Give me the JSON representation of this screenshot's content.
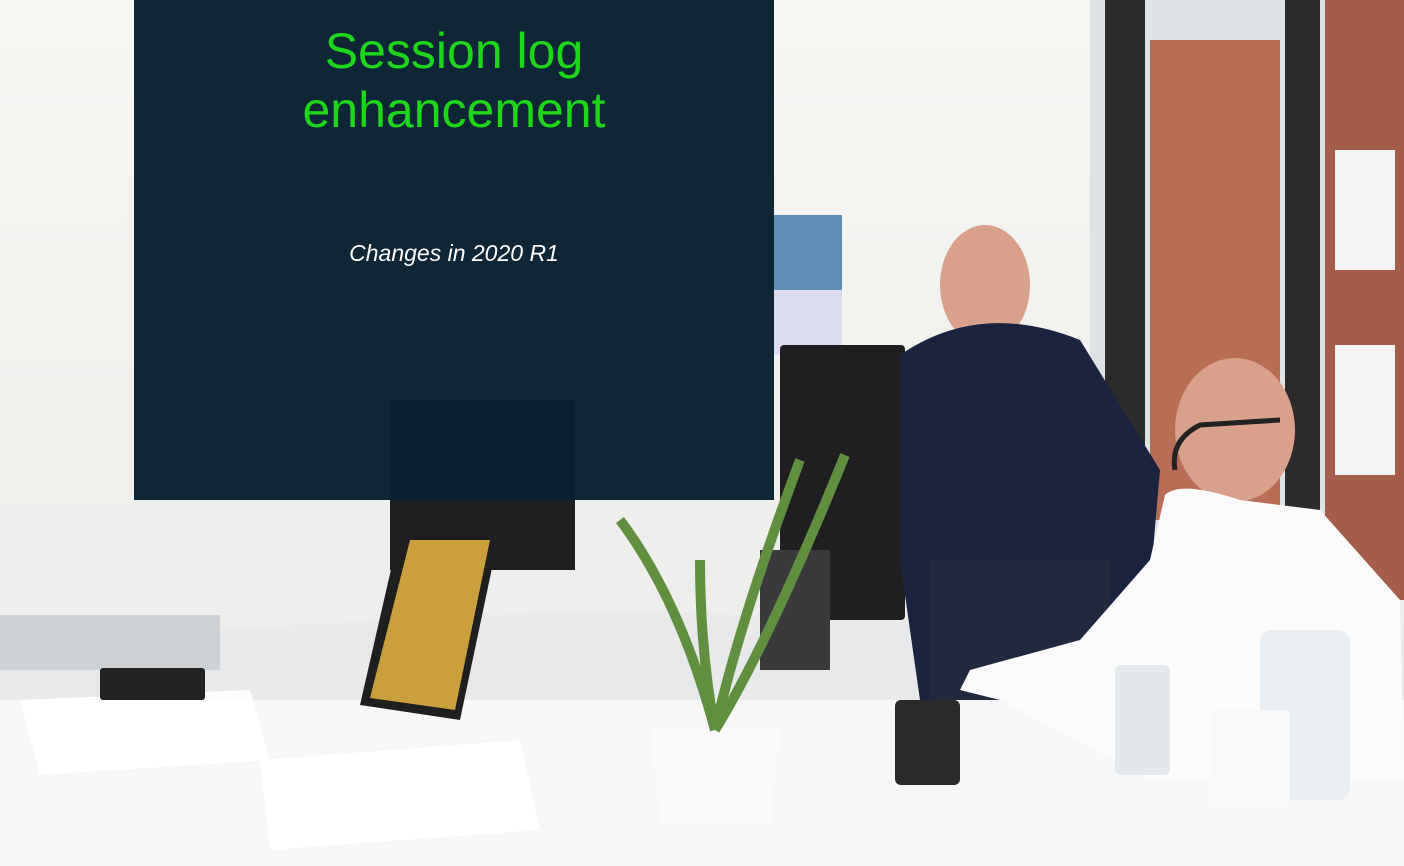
{
  "slide": {
    "title_line1": "Session log",
    "title_line2": "enhancement",
    "subtitle": "Changes in 2020 R1"
  },
  "background_photo": {
    "colors": {
      "panel": "#061f2e",
      "title": "#1ed61a",
      "subtitle": "#ffffff"
    }
  }
}
